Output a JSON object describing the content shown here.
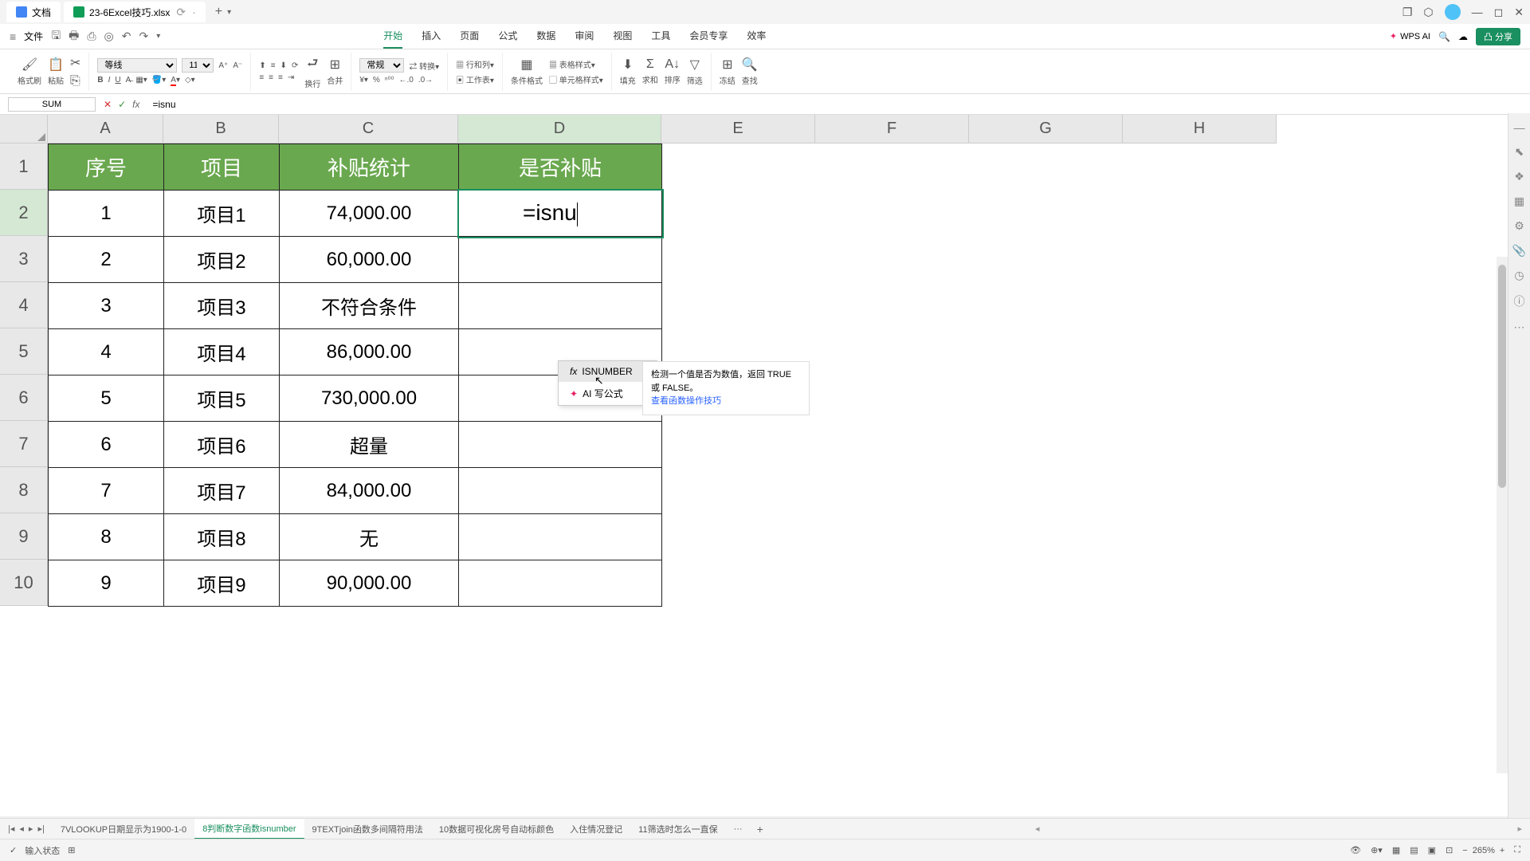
{
  "titlebar": {
    "docs_tab": "文档",
    "file_tab": "23-6Excel技巧.xlsx"
  },
  "menubar": {
    "file": "文件",
    "tabs": [
      "开始",
      "插入",
      "页面",
      "公式",
      "数据",
      "审阅",
      "视图",
      "工具",
      "会员专享",
      "效率"
    ],
    "active_tab": "开始",
    "wps_ai": "WPS AI",
    "share": "分享"
  },
  "ribbon": {
    "format_painter": "格式刷",
    "paste": "粘贴",
    "font_name": "等线",
    "font_size": "11",
    "wrap": "换行",
    "merge": "合并",
    "number_fmt": "常规",
    "convert": "转换",
    "rowcol": "行和列",
    "worksheet": "工作表",
    "cond_fmt": "条件格式",
    "table_style": "表格样式",
    "cell_style": "单元格样式",
    "fill": "填充",
    "sum": "求和",
    "sort": "排序",
    "filter": "筛选",
    "freeze": "冻结",
    "find": "查找"
  },
  "namebox": {
    "cell_ref": "SUM",
    "formula": "=isnu"
  },
  "columns": [
    "A",
    "B",
    "C",
    "D",
    "E",
    "F",
    "G",
    "H"
  ],
  "rows": [
    "1",
    "2",
    "3",
    "4",
    "5",
    "6",
    "7",
    "8",
    "9",
    "10"
  ],
  "table": {
    "headers": [
      "序号",
      "项目",
      "补贴统计",
      "是否补贴"
    ],
    "data": [
      [
        "1",
        "项目1",
        "74,000.00",
        "=isnu"
      ],
      [
        "2",
        "项目2",
        "60,000.00",
        ""
      ],
      [
        "3",
        "项目3",
        "不符合条件",
        ""
      ],
      [
        "4",
        "项目4",
        "86,000.00",
        ""
      ],
      [
        "5",
        "项目5",
        "730,000.00",
        ""
      ],
      [
        "6",
        "项目6",
        "超量",
        ""
      ],
      [
        "7",
        "项目7",
        "84,000.00",
        ""
      ],
      [
        "8",
        "项目8",
        "无",
        ""
      ],
      [
        "9",
        "项目9",
        "90,000.00",
        ""
      ]
    ]
  },
  "suggest": {
    "fn_name": "ISNUMBER",
    "ai_label": "AI 写公式",
    "desc": "检测一个值是否为数值，返回 TRUE 或 FALSE。",
    "link": "查看函数操作技巧"
  },
  "sheet_tabs": {
    "tabs": [
      "7VLOOKUP日期显示为1900-1-0",
      "8判断数字函数isnumber",
      "9TEXTjoin函数多间隔符用法",
      "10数据可视化房号自动标颜色",
      "入住情况登记",
      "11筛选时怎么一直保"
    ],
    "active": 1,
    "more": "···"
  },
  "statusbar": {
    "mode": "输入状态",
    "zoom": "265%"
  }
}
